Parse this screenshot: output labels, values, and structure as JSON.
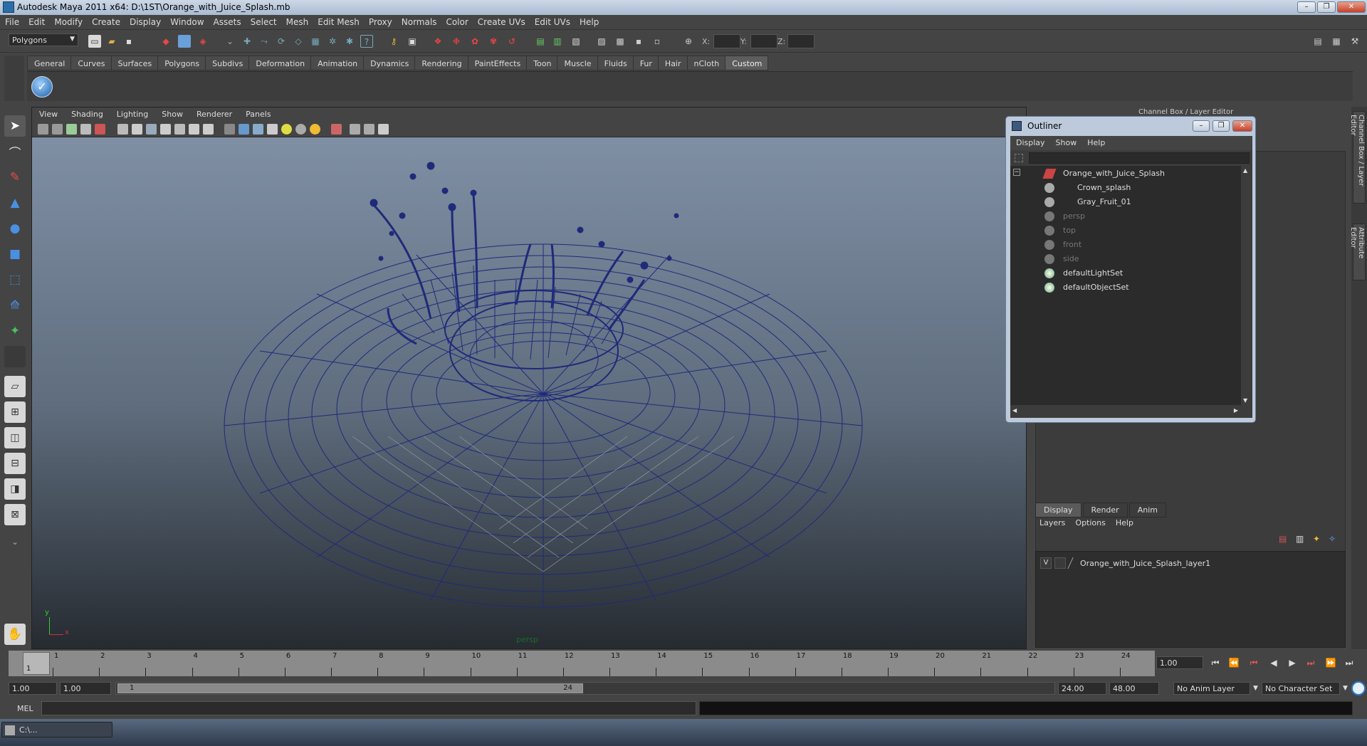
{
  "window": {
    "title": "Autodesk Maya 2011 x64: D:\\1ST\\Orange_with_Juice_Splash.mb",
    "minimize": "–",
    "restore": "❐",
    "close": "✕"
  },
  "menubar": [
    "File",
    "Edit",
    "Modify",
    "Create",
    "Display",
    "Window",
    "Assets",
    "Select",
    "Mesh",
    "Edit Mesh",
    "Proxy",
    "Normals",
    "Color",
    "Create UVs",
    "Edit UVs",
    "Help"
  ],
  "status_line": {
    "menu_set": "Polygons",
    "x_label": "X:",
    "y_label": "Y:",
    "z_label": "Z:"
  },
  "shelf": {
    "tabs": [
      "General",
      "Curves",
      "Surfaces",
      "Polygons",
      "Subdivs",
      "Deformation",
      "Animation",
      "Dynamics",
      "Rendering",
      "PaintEffects",
      "Toon",
      "Muscle",
      "Fluids",
      "Fur",
      "Hair",
      "nCloth",
      "Custom"
    ],
    "active_tab": "Custom"
  },
  "viewport": {
    "menu": [
      "View",
      "Shading",
      "Lighting",
      "Show",
      "Renderer",
      "Panels"
    ],
    "camera_label": "persp",
    "axis_y": "y",
    "axis_x": "x"
  },
  "channel_box": {
    "title": "Channel Box / Layer Editor",
    "layer_tabs": [
      "Display",
      "Render",
      "Anim"
    ],
    "active_layer_tab": "Display",
    "layer_menu": [
      "Layers",
      "Options",
      "Help"
    ],
    "layer": {
      "visibility": "V",
      "name": "Orange_with_Juice_Splash_layer1"
    }
  },
  "right_tabs": [
    "Channel Box / Layer Editor",
    "Attribute Editor"
  ],
  "outliner": {
    "title": "Outliner",
    "menu": [
      "Display",
      "Show",
      "Help"
    ],
    "nodes": [
      {
        "label": "Orange_with_Juice_Splash",
        "dim": false,
        "indent": 0
      },
      {
        "label": "Crown_splash",
        "dim": false,
        "indent": 1
      },
      {
        "label": "Gray_Fruit_01",
        "dim": false,
        "indent": 1
      },
      {
        "label": "persp",
        "dim": true,
        "indent": 0
      },
      {
        "label": "top",
        "dim": true,
        "indent": 0
      },
      {
        "label": "front",
        "dim": true,
        "indent": 0
      },
      {
        "label": "side",
        "dim": true,
        "indent": 0
      },
      {
        "label": "defaultLightSet",
        "dim": false,
        "indent": 0
      },
      {
        "label": "defaultObjectSet",
        "dim": false,
        "indent": 0
      }
    ]
  },
  "time_slider": {
    "frames": [
      "1",
      "2",
      "3",
      "4",
      "5",
      "6",
      "7",
      "8",
      "9",
      "10",
      "11",
      "12",
      "13",
      "14",
      "15",
      "16",
      "17",
      "18",
      "19",
      "20",
      "21",
      "22",
      "23",
      "24"
    ],
    "current_frame": "1",
    "current_time": "1.00"
  },
  "range_slider": {
    "start_time": "1.00",
    "playback_start": "1.00",
    "range_start": "1",
    "range_end": "24",
    "playback_end": "24.00",
    "end_time": "48.00",
    "anim_layer": "No Anim Layer",
    "character_set": "No Character Set"
  },
  "command_line": {
    "label": "MEL"
  },
  "taskbar": {
    "item": "C:\\..."
  },
  "colors": {
    "wireframe": "#1f2a7a",
    "viewport_top": "#8393a8",
    "viewport_bottom": "#262b31",
    "ui_bg": "#444444"
  }
}
